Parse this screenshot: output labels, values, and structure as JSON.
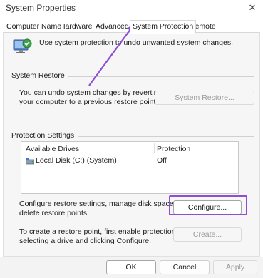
{
  "window": {
    "title": "System Properties",
    "close_glyph": "✕"
  },
  "tabs": [
    {
      "label": "Computer Name",
      "active": false
    },
    {
      "label": "Hardware",
      "active": false
    },
    {
      "label": "Advanced",
      "active": false
    },
    {
      "label": "System Protection",
      "active": true
    },
    {
      "label": "Remote",
      "active": false
    }
  ],
  "intro": "Use system protection to undo unwanted system changes.",
  "restore": {
    "group_title": "System Restore",
    "text_line1": "You can undo system changes by reverting",
    "text_line2": "your computer to a previous restore point.",
    "button": "System Restore..."
  },
  "protection": {
    "group_title": "Protection Settings",
    "columns": [
      "Available Drives",
      "Protection"
    ],
    "drives": [
      {
        "name": "Local Disk (C:) (System)",
        "protection": "Off"
      }
    ],
    "configure_text_line1": "Configure restore settings, manage disk space, and",
    "configure_text_line2": "delete restore points.",
    "configure_button": "Configure...",
    "create_text_line1": "To create a restore point, first enable protection by",
    "create_text_line2": "selecting a drive and clicking Configure.",
    "create_button": "Create..."
  },
  "footer": {
    "ok": "OK",
    "cancel": "Cancel",
    "apply": "Apply"
  },
  "colors": {
    "annotation": "#8e4ed3"
  }
}
